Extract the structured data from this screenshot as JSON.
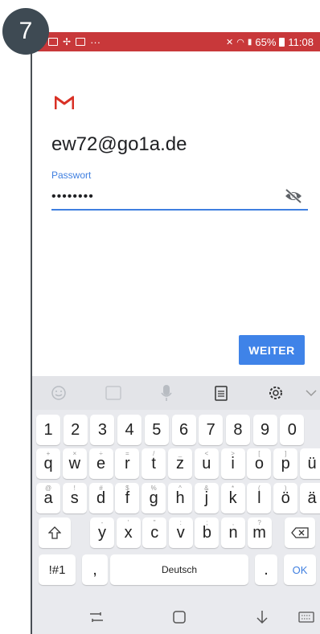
{
  "step": {
    "number": "7"
  },
  "status_bar": {
    "battery": "65%",
    "time": "11:08",
    "dots": "···"
  },
  "account": {
    "email": "ew72@go1a.de",
    "password_label": "Passwort",
    "password_value": "••••••••"
  },
  "actions": {
    "next_label": "WEITER"
  },
  "keyboard": {
    "number_row": [
      "1",
      "2",
      "3",
      "4",
      "5",
      "6",
      "7",
      "8",
      "9",
      "0"
    ],
    "row1": [
      {
        "k": "q",
        "s": "+"
      },
      {
        "k": "w",
        "s": "×"
      },
      {
        "k": "e",
        "s": "÷"
      },
      {
        "k": "r",
        "s": "="
      },
      {
        "k": "t",
        "s": "/"
      },
      {
        "k": "z",
        "s": "_"
      },
      {
        "k": "u",
        "s": "<"
      },
      {
        "k": "i",
        "s": ">"
      },
      {
        "k": "o",
        "s": "["
      },
      {
        "k": "p",
        "s": "]"
      },
      {
        "k": "ü",
        "s": ""
      }
    ],
    "row2": [
      {
        "k": "a",
        "s": "@"
      },
      {
        "k": "s",
        "s": "!"
      },
      {
        "k": "d",
        "s": "#"
      },
      {
        "k": "f",
        "s": "$"
      },
      {
        "k": "g",
        "s": "%"
      },
      {
        "k": "h",
        "s": "^"
      },
      {
        "k": "j",
        "s": "&"
      },
      {
        "k": "k",
        "s": "*"
      },
      {
        "k": "l",
        "s": "("
      },
      {
        "k": "ö",
        "s": ")"
      },
      {
        "k": "ä",
        "s": ""
      }
    ],
    "row3": [
      {
        "k": "y",
        "s": "-"
      },
      {
        "k": "x",
        "s": "'"
      },
      {
        "k": "c",
        "s": "\""
      },
      {
        "k": "v",
        "s": ":"
      },
      {
        "k": "b",
        "s": ";"
      },
      {
        "k": "n",
        "s": ","
      },
      {
        "k": "m",
        "s": "?"
      }
    ],
    "symbols_label": "!#1",
    "comma": ",",
    "space_label": "Deutsch",
    "period": ".",
    "ok_label": "OK"
  },
  "colors": {
    "status_bar": "#c8383a",
    "accent": "#3f7fe0",
    "button": "#3f83e8",
    "keyboard_bg": "#e9eaee"
  }
}
